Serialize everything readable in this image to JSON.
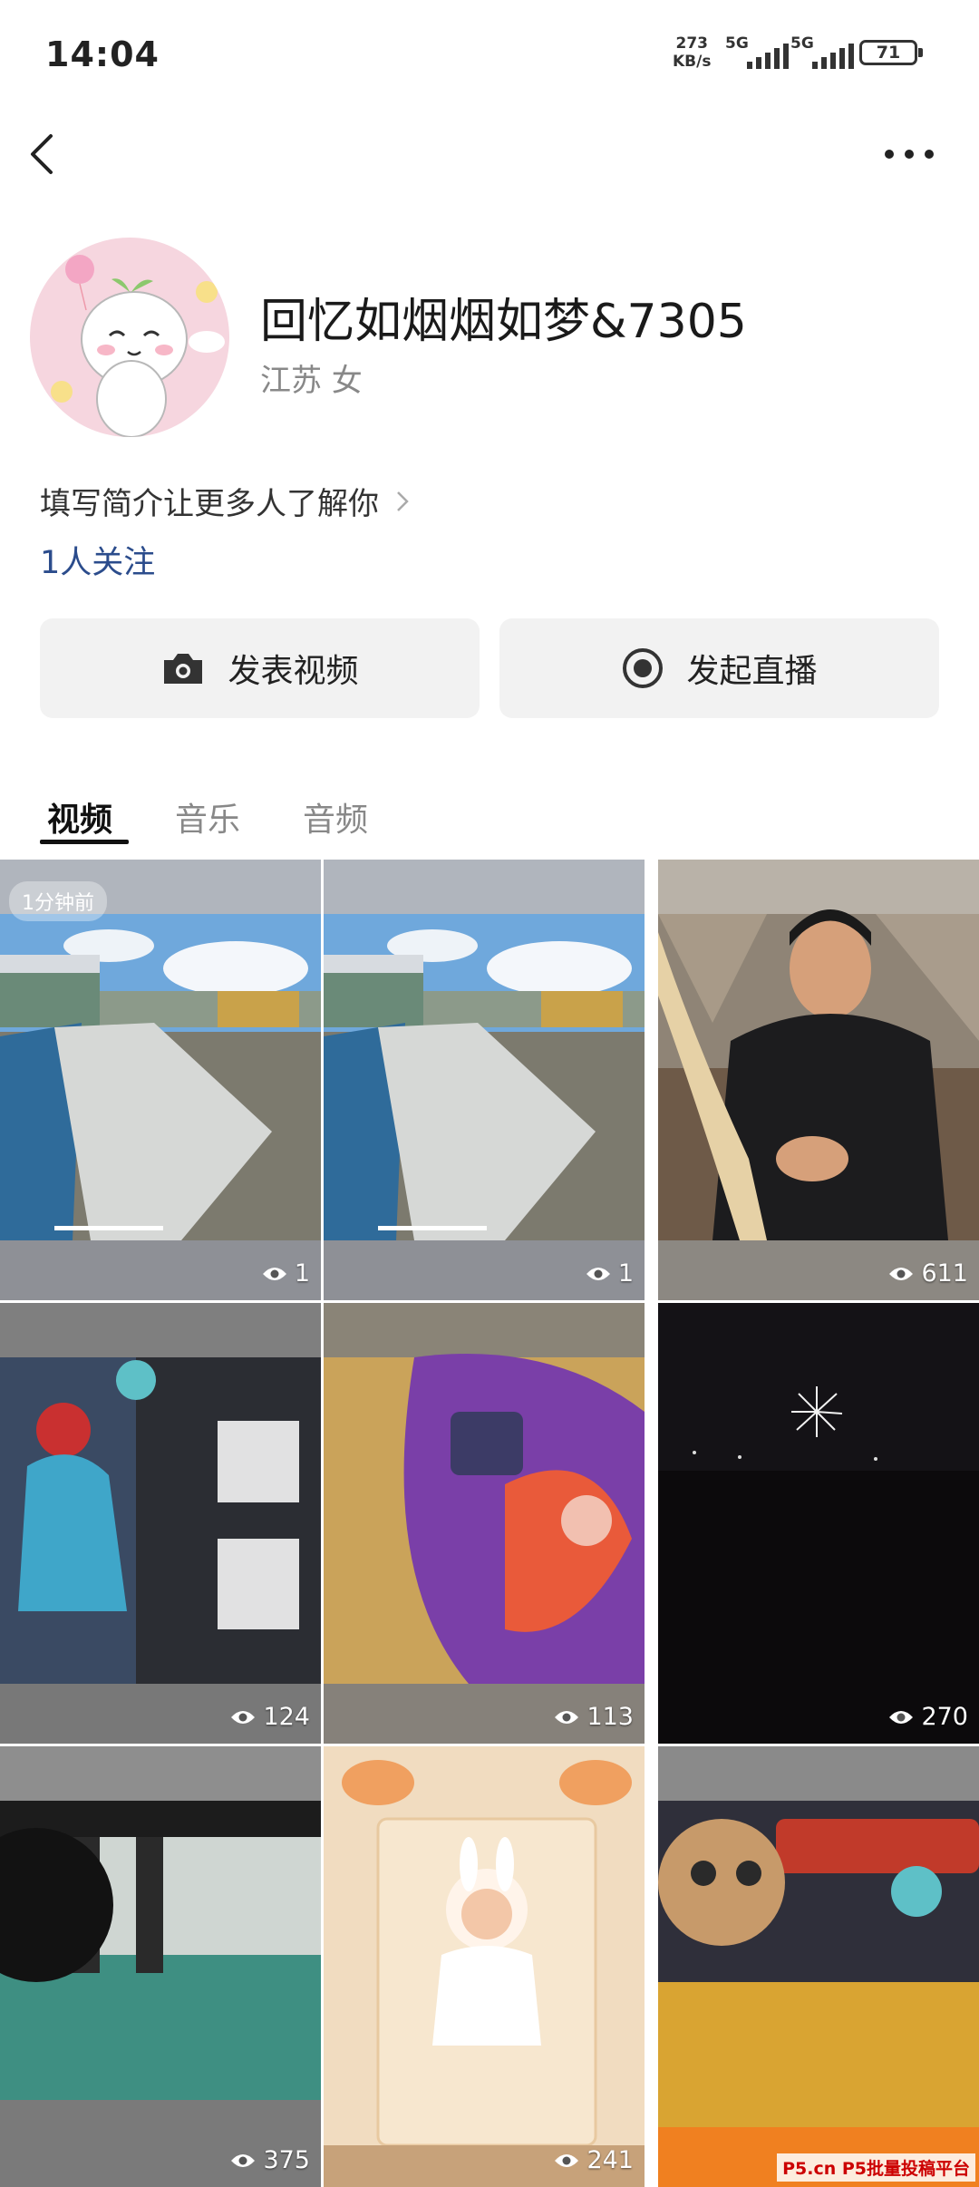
{
  "status_bar": {
    "time": "14:04",
    "net_speed_value": "273",
    "net_speed_unit": "KB/s",
    "sim1": "5G",
    "sim2": "5G",
    "battery": "71"
  },
  "profile": {
    "nickname": "回忆如烟烟如梦&7305",
    "location": "江苏 女",
    "bio_prompt": "填写简介让更多人了解你",
    "followers": "1人关注"
  },
  "actions": {
    "post_video": "发表视频",
    "start_live": "发起直播"
  },
  "tabs": [
    {
      "label": "视频",
      "active": true
    },
    {
      "label": "音乐",
      "active": false
    },
    {
      "label": "音频",
      "active": false
    }
  ],
  "videos": [
    {
      "views": "1",
      "badge": "1分钟前",
      "icon": "eye-icon"
    },
    {
      "views": "1",
      "icon": "eye-icon"
    },
    {
      "views": "611",
      "icon": "eye-icon"
    },
    {
      "views": "124",
      "icon": "eye-icon"
    },
    {
      "views": "113",
      "icon": "eye-icon"
    },
    {
      "views": "270",
      "icon": "eye-icon"
    },
    {
      "views": "375",
      "icon": "eye-icon"
    },
    {
      "views": "241",
      "icon": "eye-icon"
    },
    {
      "views": "",
      "icon": "eye-icon"
    }
  ],
  "watermark": "P5.cn P5批量投稿平台",
  "colors": {
    "link_blue": "#2b4c8c",
    "button_bg": "#f2f2f2",
    "avatar_bg": "#f6d6df"
  }
}
